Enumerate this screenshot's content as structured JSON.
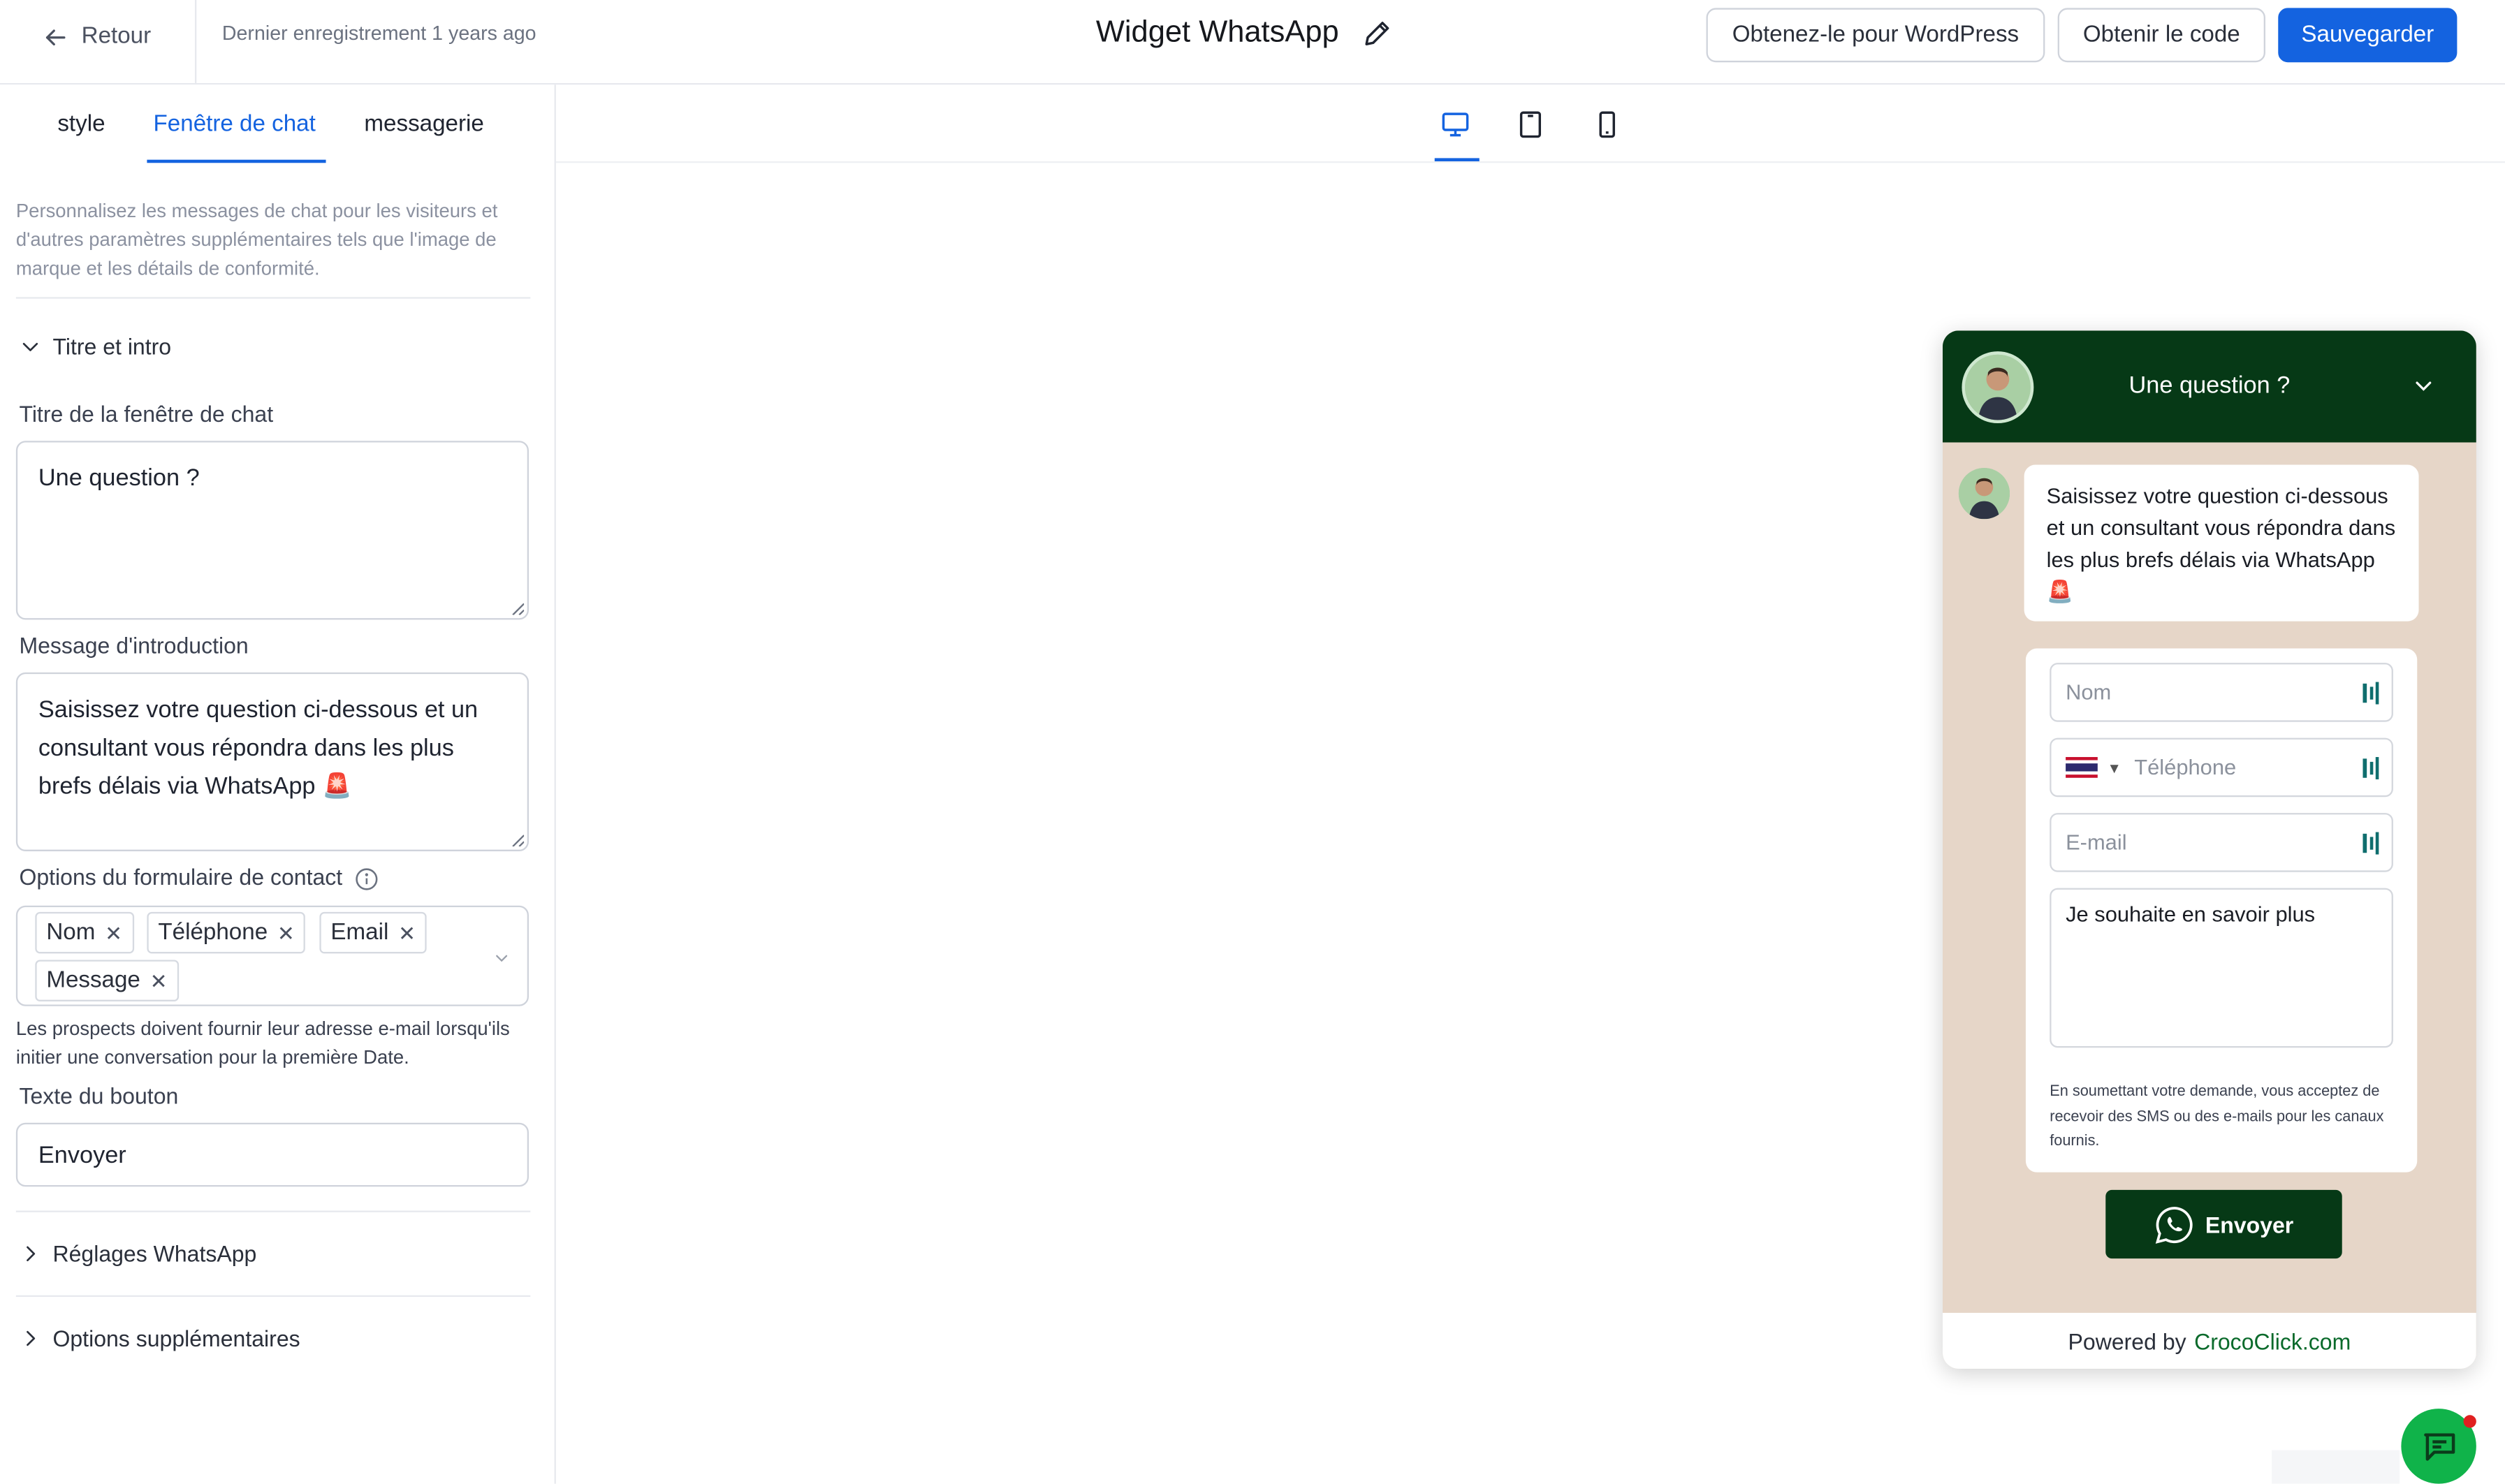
{
  "topbar": {
    "back_label": "Retour",
    "last_saved": "Dernier enregistrement 1 years ago",
    "title": "Widget WhatsApp",
    "btn_wordpress": "Obtenez-le pour WordPress",
    "btn_code": "Obtenir le code",
    "btn_save": "Sauvegarder",
    "accent_color": "#1463e0"
  },
  "tabs": [
    {
      "label": "style",
      "active": false
    },
    {
      "label": "Fenêtre de chat",
      "active": true
    },
    {
      "label": "messagerie",
      "active": false
    }
  ],
  "panel": {
    "description": "Personnalisez les messages de chat pour les visiteurs et d'autres paramètres supplémentaires tels que l'image de marque et les détails de conformité.",
    "section_title_intro": "Titre et intro",
    "chat_title_label": "Titre de la fenêtre de chat",
    "chat_title_value": "Une question ?",
    "intro_label": "Message d'introduction",
    "intro_value": "Saisissez votre question ci-dessous et un consultant vous répondra dans les plus brefs délais via WhatsApp 🚨",
    "form_options_label": "Options du formulaire de contact",
    "form_options": [
      "Nom",
      "Téléphone",
      "Email",
      "Message"
    ],
    "form_note": "Les prospects doivent fournir leur adresse e-mail lorsqu'ils initier une conversation pour la première Date.",
    "button_text_label": "Texte du bouton",
    "button_text_value": "Envoyer",
    "section_whatsapp": "Réglages WhatsApp",
    "section_extra": "Options supplémentaires"
  },
  "devices": [
    "desktop-icon",
    "tablet-icon",
    "mobile-icon"
  ],
  "widget": {
    "header_title": "Une question ?",
    "header_color": "#063916",
    "body_color": "#e6d6c8",
    "intro_message": "Saisissez votre question ci-dessous et un consultant vous répondra dans les plus brefs délais via WhatsApp 🚨",
    "name_placeholder": "Nom",
    "phone_placeholder": "Téléphone",
    "email_placeholder": "E-mail",
    "message_value": "Je souhaite en savoir plus",
    "legal_text": "En soumettant votre demande, vous acceptez de recevoir des SMS ou des e-mails pour les canaux fournis.",
    "send_label": "Envoyer",
    "powered_by": "Powered by",
    "brand_name": "CrocoClick.com"
  }
}
